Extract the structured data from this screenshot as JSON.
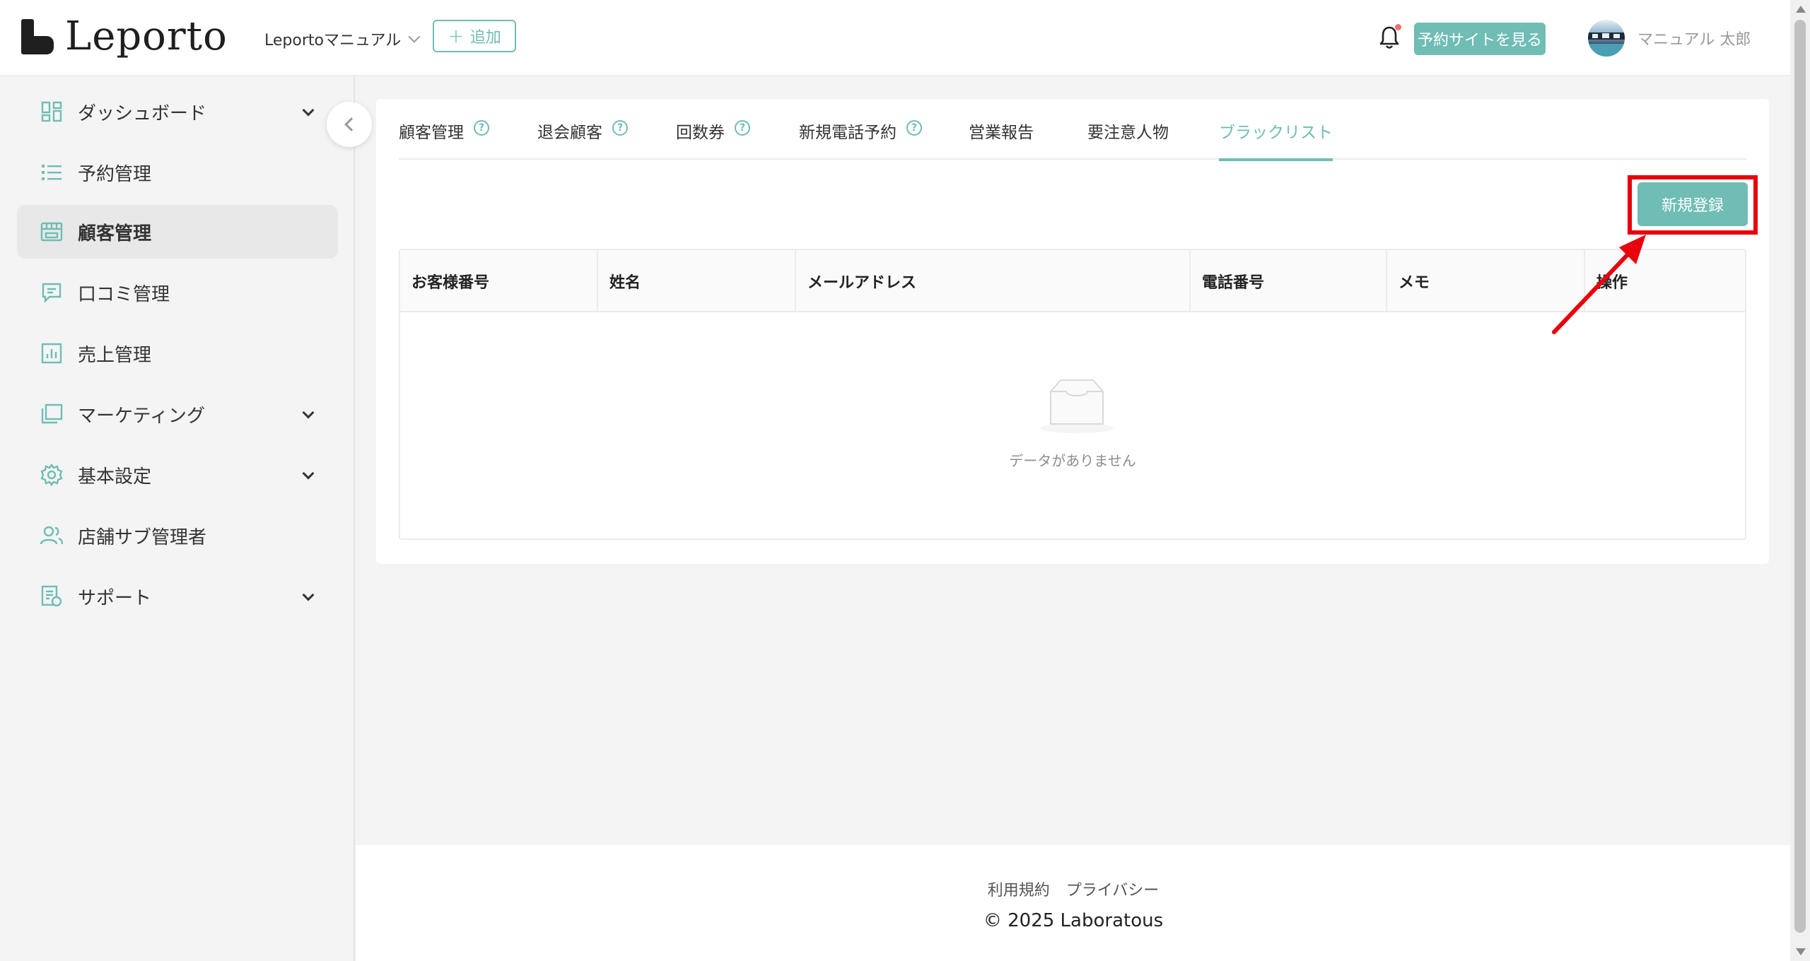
{
  "header": {
    "logo_text": "Leporto",
    "store_name": "Leportoマニュアル",
    "add_label": "追加",
    "view_site_label": "予約サイトを見る",
    "user_name": "マニュアル 太郎",
    "notification_has_unread": true
  },
  "sidebar": {
    "items": [
      {
        "label": "ダッシュボード",
        "icon": "dashboard-icon",
        "has_submenu": true
      },
      {
        "label": "予約管理",
        "icon": "list-icon",
        "has_submenu": false
      },
      {
        "label": "顧客管理",
        "icon": "store-icon",
        "has_submenu": false,
        "active": true
      },
      {
        "label": "口コミ管理",
        "icon": "review-icon",
        "has_submenu": false
      },
      {
        "label": "売上管理",
        "icon": "sales-chart-icon",
        "has_submenu": false
      },
      {
        "label": "マーケティング",
        "icon": "marketing-icon",
        "has_submenu": true
      },
      {
        "label": "基本設定",
        "icon": "gear-icon",
        "has_submenu": true
      },
      {
        "label": "店舗サブ管理者",
        "icon": "users-icon",
        "has_submenu": false
      },
      {
        "label": "サポート",
        "icon": "support-icon",
        "has_submenu": true
      }
    ]
  },
  "tabs": [
    {
      "label": "顧客管理",
      "help": true
    },
    {
      "label": "退会顧客",
      "help": true
    },
    {
      "label": "回数券",
      "help": true
    },
    {
      "label": "新規電話予約",
      "help": true
    },
    {
      "label": "営業報告",
      "help": false
    },
    {
      "label": "要注意人物",
      "help": false
    },
    {
      "label": "ブラックリスト",
      "help": false,
      "active": true
    }
  ],
  "toolbar": {
    "new_register_label": "新規登録"
  },
  "table": {
    "columns": [
      "お客様番号",
      "姓名",
      "メールアドレス",
      "電話番号",
      "メモ",
      "操作"
    ],
    "rows": [],
    "empty_text": "データがありません"
  },
  "footer": {
    "links": [
      "利用規約",
      "プライバシー"
    ],
    "copyright": "2025 Laboratous"
  },
  "colors": {
    "accent": "#6fbdb4",
    "highlight": "#e8000d",
    "notification_dot": "#f56c6c"
  }
}
